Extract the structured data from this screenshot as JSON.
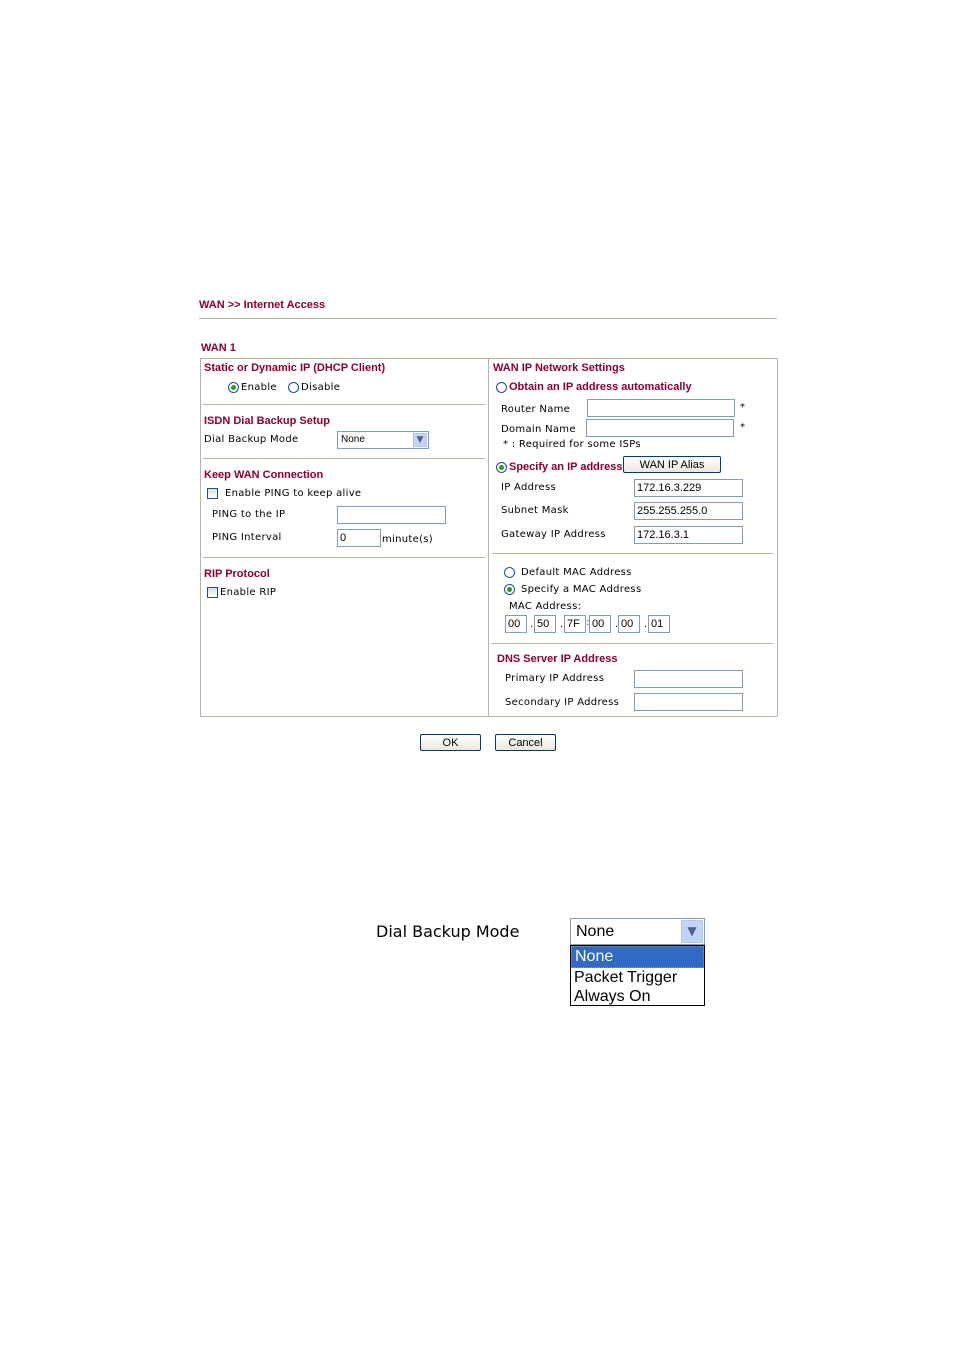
{
  "breadcrumb": "WAN >> Internet Access",
  "section_title": "WAN 1",
  "left": {
    "static_dynamic": {
      "title": "Static or Dynamic IP (DHCP Client)",
      "options": [
        {
          "label": "Enable",
          "selected": true
        },
        {
          "label": "Disable",
          "selected": false
        }
      ]
    },
    "isdn": {
      "title": "ISDN Dial Backup Setup",
      "mode_label": "Dial Backup Mode",
      "mode_value": "None",
      "arrow_icon": "chevron-down-icon"
    },
    "keep_wan": {
      "title": "Keep WAN Connection",
      "enable_ping_label": "Enable PING to keep alive",
      "enable_ping_checked": false,
      "ping_ip_label": "PING to the IP",
      "ping_ip_value": "",
      "ping_interval_label": "PING Interval",
      "ping_interval_value": "0",
      "ping_interval_unit": "minute(s)"
    },
    "rip": {
      "title": "RIP Protocol",
      "enable_label": "Enable RIP",
      "enable_checked": false
    }
  },
  "right": {
    "title": "WAN IP Network Settings",
    "obtain_auto": {
      "label": "Obtain an IP address automatically",
      "selected": false
    },
    "router_name_label": "Router Name",
    "router_name_value": "",
    "domain_name_label": "Domain Name",
    "domain_name_value": "",
    "required_mark": "*",
    "required_note": "* : Required for some ISPs",
    "specify_ip": {
      "label": "Specify an IP address",
      "selected": true
    },
    "wan_ip_alias_button": "WAN IP Alias",
    "ip_address_label": "IP Address",
    "ip_address_value": "172.16.3.229",
    "subnet_mask_label": "Subnet Mask",
    "subnet_mask_value": "255.255.255.0",
    "gateway_label": "Gateway IP Address",
    "gateway_value": "172.16.3.1",
    "mac": {
      "default_label": "Default MAC Address",
      "default_selected": false,
      "specify_label": "Specify a MAC Address",
      "specify_selected": true,
      "mac_label": "MAC Address:",
      "octets": [
        "00",
        "50",
        "7F",
        "00",
        "00",
        "01"
      ],
      "separators": [
        ".",
        ".",
        ":",
        ".",
        "."
      ]
    },
    "dns": {
      "title": "DNS Server IP Address",
      "primary_label": "Primary IP Address",
      "primary_value": "",
      "secondary_label": "Secondary IP Address",
      "secondary_value": ""
    }
  },
  "buttons": {
    "ok": "OK",
    "cancel": "Cancel"
  },
  "dropdown_demo": {
    "label": "Dial Backup Mode",
    "selected": "None",
    "options": [
      "None",
      "Packet Trigger",
      "Always On"
    ],
    "highlight_color": "#316ac5"
  },
  "colors": {
    "header": "#8b0030",
    "border": "#b8b4a0",
    "input_border": "#7f9db9"
  }
}
